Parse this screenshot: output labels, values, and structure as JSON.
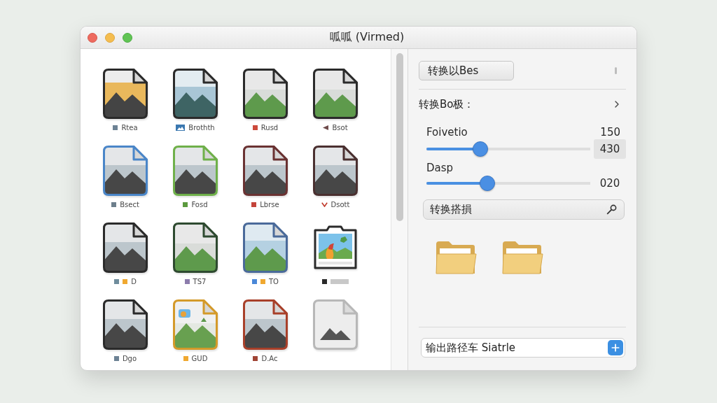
{
  "window": {
    "title": "呱呱 (Virmed)"
  },
  "files": [
    {
      "label": "Rtea",
      "kind": "sunset-doc",
      "color": "#2b2b2b",
      "tags": [
        {
          "kind": "square",
          "color": "#6d8294"
        }
      ]
    },
    {
      "label": "Brothth",
      "kind": "teal-doc",
      "color": "#2b2b2b",
      "tags": [
        {
          "kind": "picture",
          "color": "#3b78b0"
        }
      ]
    },
    {
      "label": "Rusd",
      "kind": "green-doc",
      "color": "#2b2b2b",
      "tags": [
        {
          "kind": "square",
          "color": "#cc4a3c"
        }
      ]
    },
    {
      "label": "Bsot",
      "kind": "green-doc",
      "color": "#2b2b2b",
      "tags": [
        {
          "kind": "arrow",
          "color": "#6e4a4a"
        }
      ]
    },
    {
      "label": "Bsect",
      "kind": "dark-doc",
      "color": "#4a86c8",
      "tags": [
        {
          "kind": "square",
          "color": "#6d7f8c"
        }
      ]
    },
    {
      "label": "Fosd",
      "kind": "dark-doc",
      "color": "#6fb04a",
      "tags": [
        {
          "kind": "square",
          "color": "#5c9a3e"
        }
      ]
    },
    {
      "label": "Lbrse",
      "kind": "dark-doc",
      "color": "#6a3232",
      "tags": [
        {
          "kind": "square",
          "color": "#c4443a"
        }
      ]
    },
    {
      "label": "Dsott",
      "kind": "dark-doc",
      "color": "#4a3030",
      "tags": [
        {
          "kind": "chevron",
          "color": "#c0392b"
        }
      ]
    },
    {
      "label": "D",
      "kind": "dark-doc",
      "color": "#2b2b2b",
      "tags": [
        {
          "kind": "square",
          "color": "#6f8c9c"
        },
        {
          "kind": "square",
          "color": "#f0a830"
        }
      ]
    },
    {
      "label": "TS7",
      "kind": "green-doc",
      "color": "#2e4a30",
      "tags": [
        {
          "kind": "square",
          "color": "#8c7cac"
        }
      ]
    },
    {
      "label": "TO",
      "kind": "meadow-doc",
      "color": "#4a6a9a",
      "tags": [
        {
          "kind": "square",
          "color": "#4a88d8"
        },
        {
          "kind": "square",
          "color": "#f0a830"
        }
      ]
    },
    {
      "kind": "album",
      "color": "#2b2b2b",
      "tags": [
        {
          "kind": "square",
          "color": "#2a2a2a"
        },
        {
          "kind": "bar",
          "color": "#c8c8c8"
        }
      ]
    },
    {
      "label": "Dgo",
      "kind": "dark-doc",
      "color": "#2b2b2b",
      "tags": [
        {
          "kind": "square",
          "color": "#6d8294"
        }
      ]
    },
    {
      "label": "GUD",
      "kind": "sticker-doc",
      "color": "#d49a2a",
      "tags": [
        {
          "kind": "square",
          "color": "#f0a830"
        }
      ]
    },
    {
      "label": "D.Ac",
      "kind": "dark-doc",
      "color": "#a8402a",
      "tags": [
        {
          "kind": "square",
          "color": "#a04535"
        }
      ]
    },
    {
      "kind": "faded-doc",
      "color": "#b8b8b8"
    }
  ],
  "inspector": {
    "format_button": {
      "label": "转换以Bes"
    },
    "section": {
      "label": "转换Bo极："
    },
    "sliders": [
      {
        "label": "Foivetio",
        "reading": "150",
        "level": 0.31,
        "value": "430",
        "boxed": true
      },
      {
        "label": "Dasp",
        "level": 0.36,
        "value": "020",
        "boxed": false
      }
    ],
    "search": {
      "value": "转换搭損"
    },
    "output": {
      "value": "输出路径车 Siatrle"
    }
  }
}
